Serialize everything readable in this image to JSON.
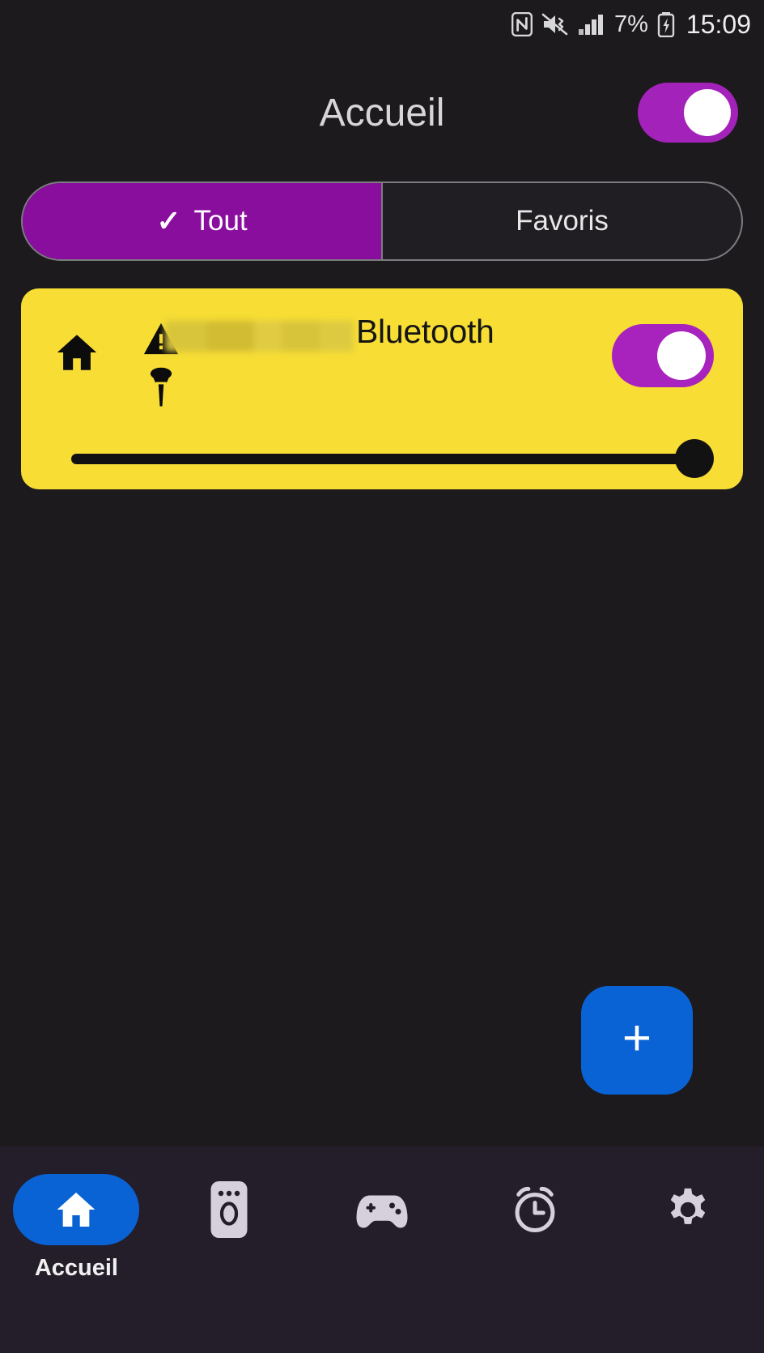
{
  "status_bar": {
    "nfc_icon": "nfc-icon",
    "sound_icon": "vibrate-mute-icon",
    "signal_icon": "signal-bars-icon",
    "battery_percent": "7%",
    "battery_icon": "battery-charging-icon",
    "clock": "15:09"
  },
  "header": {
    "title": "Accueil",
    "master_toggle": {
      "name": "master-power-toggle",
      "state": "on",
      "color": "#a322b9"
    }
  },
  "tabs": {
    "items": [
      {
        "label": "Tout",
        "active": true,
        "icon": "check-icon",
        "check": "✓"
      },
      {
        "label": "Favoris",
        "active": false
      }
    ],
    "active_color": "#8a0e9e",
    "border_color": "#7c7c80"
  },
  "devices": [
    {
      "name": "bluetooth-device-card",
      "card_color": "#f7dd34",
      "room_icon": "home-icon",
      "warning_icon": "warning-triangle-icon",
      "mic_icon": "microphone-icon",
      "redacted_label": "",
      "label": "Bluetooth",
      "toggle": {
        "state": "on",
        "color": "#a822be"
      },
      "slider": {
        "value": 100,
        "track_color": "#111111"
      }
    }
  ],
  "fab": {
    "label": "+",
    "name": "add-device-fab",
    "color": "#0a63d4"
  },
  "bottom_nav": {
    "background": "#241d2a",
    "active_color": "#0a63d4",
    "items": [
      {
        "label": "Accueil",
        "icon": "home-icon",
        "active": true
      },
      {
        "label": "",
        "icon": "remote-control-icon",
        "active": false
      },
      {
        "label": "",
        "icon": "gamepad-icon",
        "active": false
      },
      {
        "label": "",
        "icon": "alarm-clock-icon",
        "active": false
      },
      {
        "label": "",
        "icon": "gear-icon",
        "active": false
      }
    ]
  }
}
